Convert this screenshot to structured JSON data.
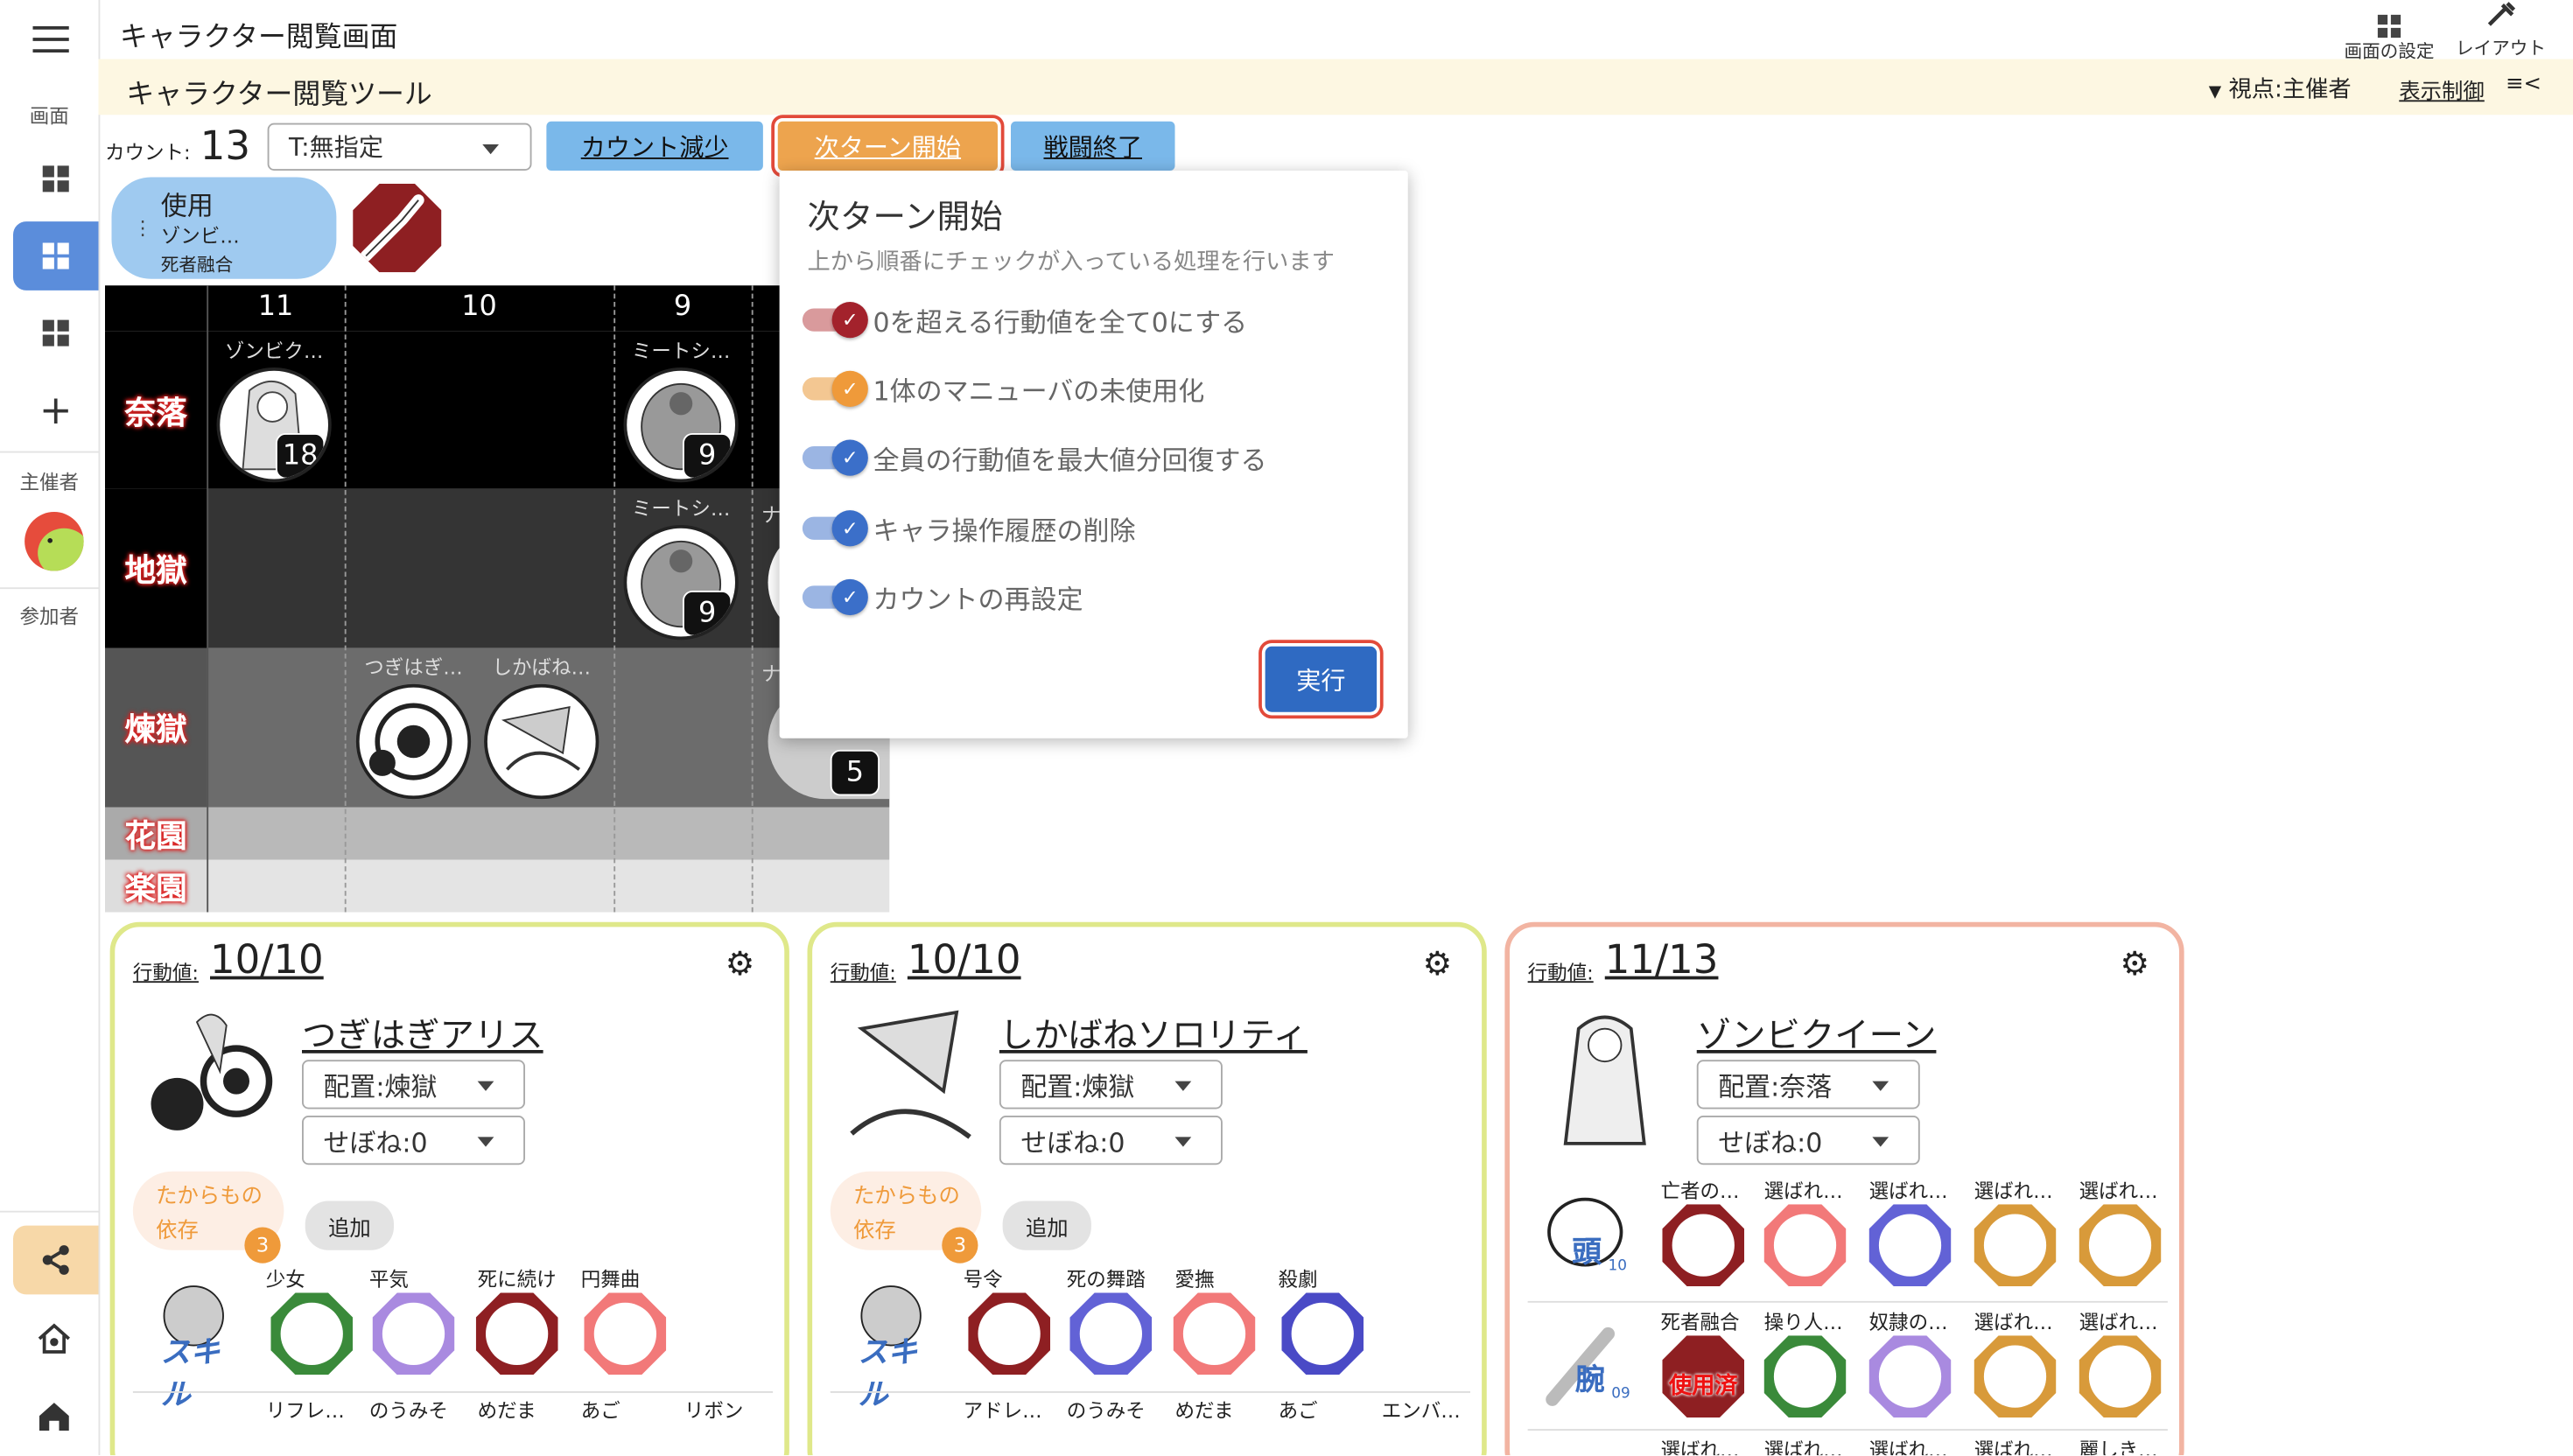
{
  "header": {
    "title": "キャラクター閲覧画面",
    "screen_settings": "画面の設定",
    "layout": "レイアウト",
    "tool_name": "キャラクター閲覧ツール",
    "viewpoint": "視点:主催者",
    "display_control": "表示制御"
  },
  "sidebar": {
    "screen_label": "画面",
    "host_label": "主催者",
    "participants_label": "参加者"
  },
  "toolbar": {
    "count_label": "カウント:",
    "count_value": "13",
    "target_select": "T:無指定",
    "decrease_button": "カウント減少",
    "next_turn_button": "次ターン開始",
    "end_battle_button": "戦闘終了"
  },
  "usage_chip": {
    "title": "使用",
    "line1": "ゾンビ…",
    "line2": "死者融合"
  },
  "board": {
    "columns": [
      "11",
      "10",
      "9"
    ],
    "rows": [
      "奈落",
      "地獄",
      "煉獄",
      "花園",
      "楽園"
    ],
    "tokens": {
      "zombie_name": "ゾンビク…",
      "zombie_value": "18",
      "meat1_name": "ミートシ…",
      "meat1_value": "9",
      "meat2_name": "ミートシ…",
      "meat2_value": "9",
      "tsugi_name": "つぎはぎ…",
      "shika_name": "しかばね…",
      "partial_name": "ナ",
      "partial_value": "5"
    }
  },
  "popover": {
    "title": "次ターン開始",
    "subtitle": "上から順番にチェックが入っている処理を行います",
    "options": [
      {
        "label": "0を超える行動値を全て0にする",
        "checked": true,
        "color": "#a3222c"
      },
      {
        "label": "1体のマニューバの未使用化",
        "checked": true,
        "color": "#ef9a3a"
      },
      {
        "label": "全員の行動値を最大値分回復する",
        "checked": true,
        "color": "#3b6fc9"
      },
      {
        "label": "キャラ操作履歴の削除",
        "checked": true,
        "color": "#3b6fc9"
      },
      {
        "label": "カウントの再設定",
        "checked": true,
        "color": "#3b6fc9"
      }
    ],
    "execute_button": "実行"
  },
  "cards": [
    {
      "action_label": "行動値:",
      "action_value": "10/10",
      "name": "つぎはぎアリス",
      "placement": "配置:煉獄",
      "sebone": "せぼね:0",
      "treasure_line1": "たからもの",
      "treasure_line2": "依存",
      "treasure_count": "3",
      "add": "追加",
      "skill_text": "スキル",
      "skills": [
        "少女",
        "平気",
        "死に続け",
        "円舞曲"
      ],
      "row2": [
        "リフレ…",
        "のうみそ",
        "めだま",
        "あご",
        "リボン"
      ]
    },
    {
      "action_label": "行動値:",
      "action_value": "10/10",
      "name": "しかばねソロリティ",
      "placement": "配置:煉獄",
      "sebone": "せぼね:0",
      "treasure_line1": "たからもの",
      "treasure_line2": "依存",
      "treasure_count": "3",
      "add": "追加",
      "skill_text": "スキル",
      "skills": [
        "号令",
        "死の舞踏",
        "愛撫",
        "殺劇"
      ],
      "row2": [
        "アドレ…",
        "のうみそ",
        "めだま",
        "あご",
        "エンバ…"
      ]
    },
    {
      "action_label": "行動値:",
      "action_value": "11/13",
      "name": "ゾンビクイーン",
      "placement": "配置:奈落",
      "sebone": "せぼね:0",
      "head_text": "頭",
      "head_num": "10",
      "head_parts": [
        "亡者の…",
        "選ばれ…",
        "選ばれ…",
        "選ばれ…",
        "選ばれ…"
      ],
      "arm_text": "腕",
      "arm_num": "09",
      "arm_parts": [
        "死者融合",
        "操り人…",
        "奴隷の…",
        "選ばれ…",
        "選ばれ…"
      ],
      "used_text": "使用済",
      "row3": [
        "選ばれ…",
        "選ばれ…",
        "選ばれ…",
        "選ばれ…",
        "麗しき…"
      ]
    }
  ],
  "colors": {
    "accent_blue": "#7ab8ea",
    "accent_orange": "#eda44e",
    "execute_blue": "#2f6ac2",
    "card_border_green": "#dfe88a",
    "card_border_pink": "#f2b4a2"
  }
}
